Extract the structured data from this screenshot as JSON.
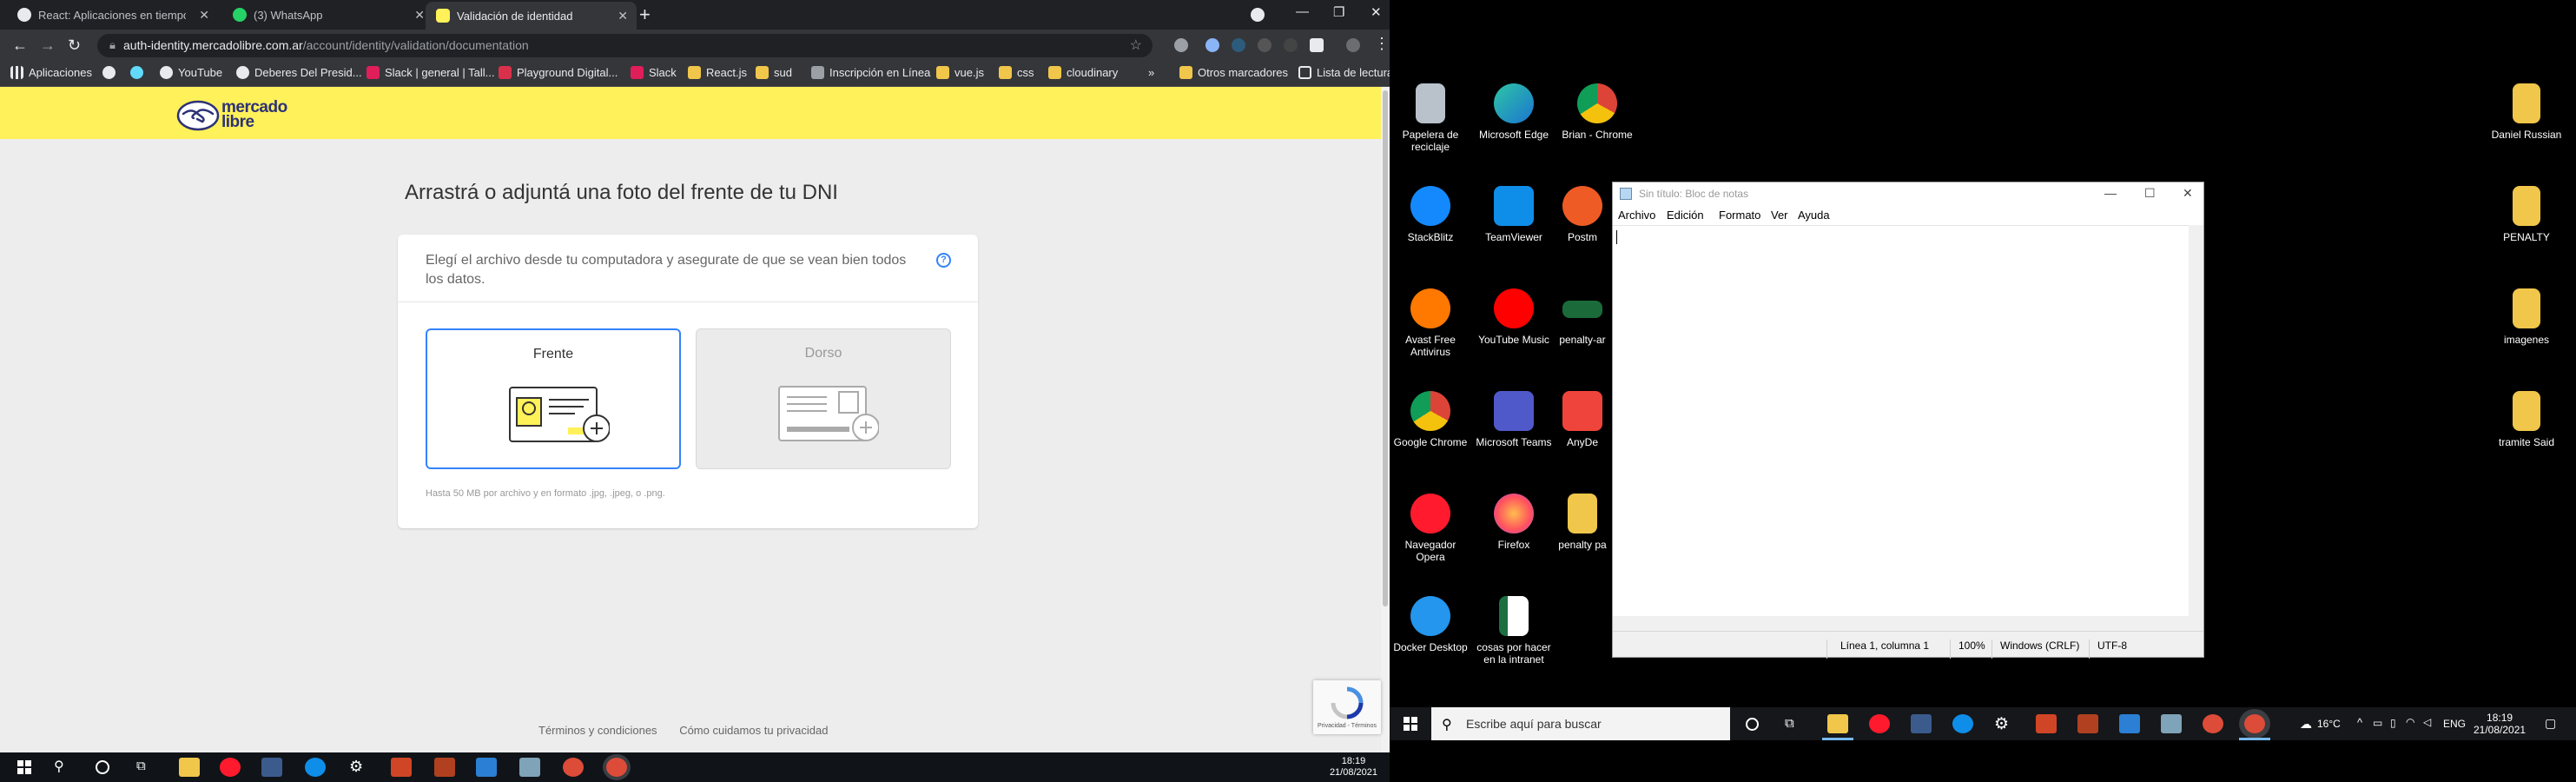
{
  "monitor1": {
    "chrome": {
      "tabs": [
        {
          "title": "React: Aplicaciones en tiempo re",
          "close": "✕"
        },
        {
          "title": "(3) WhatsApp",
          "close": "✕"
        },
        {
          "title": "Validación de identidad",
          "close": "✕"
        }
      ],
      "new_tab": "+",
      "window_controls": [
        "—",
        "❐",
        "✕"
      ],
      "url_host": "auth-identity.mercadolibre.com.ar",
      "url_path": "/account/identity/validation/documentation",
      "bookmarks": [
        "Aplicaciones",
        "YouTube",
        "Deberes Del Presid...",
        "Slack | general | Tall...",
        "Playground Digital...",
        "Slack",
        "React.js",
        "sud",
        "Inscripción en Línea",
        "vue.js",
        "css",
        "cloudinary"
      ],
      "bookmarks_more": "»",
      "other_bookmarks": "Otros marcadores",
      "reading_list": "Lista de lectura"
    },
    "page": {
      "logo_text_1": "mercado",
      "logo_text_2": "libre",
      "title": "Arrastrá o adjuntá una foto del frente de tu DNI",
      "description": "Elegí el archivo desde tu computadora y asegurate de que se vean bien todos los datos.",
      "help": "?",
      "option_front": "Frente",
      "option_back": "Dorso",
      "hint": "Hasta 50 MB por archivo y en formato .jpg, .jpeg, o .png.",
      "footer_links": [
        "Términos y condiciones",
        "Cómo cuidamos tu privacidad"
      ],
      "recaptcha_text": "Privacidad - Términos"
    },
    "taskbar": {
      "time": "18:19",
      "date": "21/08/2021"
    }
  },
  "monitor2": {
    "desktop_icons": [
      {
        "label": "Papelera de reciclaje"
      },
      {
        "label": "Microsoft Edge"
      },
      {
        "label": "Brian - Chrome"
      },
      {
        "label": "StackBlitz"
      },
      {
        "label": "TeamViewer"
      },
      {
        "label": "Postm"
      },
      {
        "label": "Avast Free Antivirus"
      },
      {
        "label": "YouTube Music"
      },
      {
        "label": "penalty-ar"
      },
      {
        "label": "Google Chrome"
      },
      {
        "label": "Microsoft Teams"
      },
      {
        "label": "AnyDe"
      },
      {
        "label": "Navegador Opera"
      },
      {
        "label": "Firefox"
      },
      {
        "label": "penalty pa"
      },
      {
        "label": "Docker Desktop"
      },
      {
        "label": "cosas por hacer en la intranet"
      },
      {
        "label": "Daniel Russian"
      },
      {
        "label": "PENALTY"
      },
      {
        "label": "imagenes"
      },
      {
        "label": "tramite Said"
      }
    ],
    "notepad": {
      "title": "Sin título: Bloc de notas",
      "menu": [
        "Archivo",
        "Edición",
        "Formato",
        "Ver",
        "Ayuda"
      ],
      "status_position": "Línea 1, columna 1",
      "status_zoom": "100%",
      "status_eol": "Windows (CRLF)",
      "status_encoding": "UTF-8"
    },
    "taskbar": {
      "search_placeholder": "Escribe aquí para buscar",
      "weather": "16°C",
      "language": "ENG",
      "time": "18:19",
      "date": "21/08/2021"
    }
  },
  "colors": {
    "ml_yellow": "#fff159",
    "ml_blue": "#3483fa",
    "chrome_dark": "#202124",
    "chrome_toolbar": "#35363a"
  }
}
